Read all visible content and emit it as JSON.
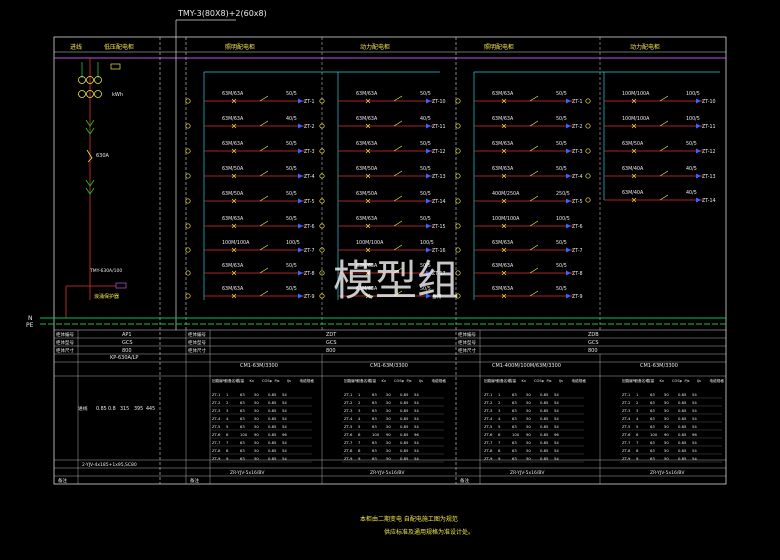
{
  "drawing": {
    "busbar_label": "TMY-3(80X8)+2(60x8)",
    "line_n": "N",
    "line_pe": "PE",
    "watermark": "模型组",
    "note_line1": "本柜由二期变电 自配电施工图为规范",
    "note_line2": "供应标准及通用规格为准设计处。"
  },
  "panels": [
    {
      "id": "incoming",
      "headers": [
        "进线",
        "低压配电柜"
      ],
      "breaker_note": "630A",
      "meter_label": "kWh",
      "ct_label": "TMY-630A/100",
      "spd_label": "浪涌保护器"
    },
    {
      "id": "p2",
      "headers": [
        "照明配电柜",
        "动力配电柜"
      ],
      "circuits": [
        {
          "rating": "63M/63A",
          "fuse": "50/5",
          "code": "ZT-1",
          "code2": "ZT-10"
        },
        {
          "rating": "63M/63A",
          "fuse": "40/5",
          "code": "ZT-2",
          "code2": "ZT-11"
        },
        {
          "rating": "63M/63A",
          "fuse": "50/5",
          "code": "ZT-3",
          "code2": "ZT-12"
        },
        {
          "rating": "63M/50A",
          "fuse": "50/5",
          "code": "ZT-4",
          "code2": "ZT-13"
        },
        {
          "rating": "63M/50A",
          "fuse": "50/5",
          "code": "ZT-5",
          "code2": "ZT-14"
        },
        {
          "rating": "63M/63A",
          "fuse": "50/5",
          "code": "ZT-6",
          "code2": "ZT-15"
        },
        {
          "rating": "100M/100A",
          "fuse": "100/5",
          "code": "ZT-7",
          "code2": "ZT-16"
        },
        {
          "rating": "63M/63A",
          "fuse": "50/5",
          "code": "ZT-8",
          "code2": "ZT-17"
        },
        {
          "rating": "63M/63A",
          "fuse": "50/5",
          "code": "ZT-9",
          "code2": "备用"
        }
      ]
    },
    {
      "id": "p3",
      "headers": [
        "照明配电柜",
        "动力配电柜"
      ],
      "circuits": [
        {
          "rating": "63M/63A",
          "fuse": "50/5",
          "code": "ZT-1",
          "code2": "ZT-10"
        },
        {
          "rating": "63M/63A",
          "fuse": "50/5",
          "code": "ZT-2",
          "code2": "ZT-11"
        },
        {
          "rating": "63M/63A",
          "fuse": "50/5",
          "code": "ZT-3",
          "code2": "ZT-12"
        },
        {
          "rating": "63M/63A",
          "fuse": "50/5",
          "code": "ZT-4",
          "code2": "ZT-13"
        },
        {
          "rating": "400M/250A",
          "fuse": "250/5",
          "code": "ZT-5",
          "code2": "ZT-14"
        },
        {
          "rating": "100M/100A",
          "fuse": "100/5",
          "code": "ZT-6"
        },
        {
          "rating": "63M/63A",
          "fuse": "50/5",
          "code": "ZT-7"
        },
        {
          "rating": "63M/63A",
          "fuse": "50/5",
          "code": "ZT-8"
        },
        {
          "rating": "63M/63A",
          "fuse": "50/5",
          "code": "ZT-9"
        }
      ],
      "right_circuits": [
        {
          "rating": "100M/100A",
          "fuse": "100/5",
          "code": "ZT-10"
        },
        {
          "rating": "100M/100A",
          "fuse": "100/5",
          "code": "ZT-11"
        },
        {
          "rating": "63M/50A",
          "fuse": "50/5",
          "code": "ZT-12"
        },
        {
          "rating": "63M/40A",
          "fuse": "40/5",
          "code": "ZT-13"
        },
        {
          "rating": "63M/40A",
          "fuse": "40/5",
          "code": "ZT-14"
        }
      ]
    }
  ],
  "table": {
    "row_labels": [
      "柜体编号",
      "柜体型号",
      "柜体尺寸"
    ],
    "cabinet_ids": [
      "AP1",
      "ZDT",
      "ZDB"
    ],
    "cabinet_types": [
      "GCS",
      "GCS",
      "GCS"
    ],
    "cabinet_sizes": [
      "800",
      "800",
      "800"
    ],
    "breaker_models": [
      "KP-630A/LP",
      "CM1-63M/3300",
      "CM1-63M/3300",
      "CM1-400M/100M/63M/3300",
      "CM1-63M/3300"
    ],
    "col_headers": [
      "回路编号",
      "设备名称",
      "容量",
      "Kx",
      "COSφ",
      "Pjs",
      "Ijs",
      "电缆规格"
    ],
    "incoming_values": [
      "进线",
      "0.85",
      "0.8",
      "315",
      "395",
      "445"
    ],
    "footer_cables": [
      "2-YJV-4x185+1x95,SC80",
      "ZR-YJV-5x16/BV",
      "ZR-YJV-5x16/BV",
      "ZR-YJV-5x16/BV",
      "ZR-YJV-5x16/BV"
    ],
    "footer_note": "备注",
    "rows": [
      [
        "ZT-1",
        "1",
        "63",
        "50",
        "0.85",
        "54"
      ],
      [
        "ZT-2",
        "2",
        "63",
        "50",
        "0.85",
        "54"
      ],
      [
        "ZT-3",
        "3",
        "63",
        "50",
        "0.85",
        "54"
      ],
      [
        "ZT-4",
        "4",
        "63",
        "50",
        "0.85",
        "54"
      ],
      [
        "ZT-5",
        "5",
        "63",
        "50",
        "0.85",
        "54"
      ],
      [
        "ZT-6",
        "6",
        "100",
        "90",
        "0.85",
        "96"
      ],
      [
        "ZT-7",
        "7",
        "63",
        "50",
        "0.85",
        "54"
      ],
      [
        "ZT-8",
        "8",
        "63",
        "50",
        "0.85",
        "54"
      ],
      [
        "ZT-9",
        "9",
        "63",
        "50",
        "0.85",
        "54"
      ]
    ]
  },
  "colors": {
    "bg": "#000000",
    "frame": "#e6e6e6",
    "busbar": "#c050e0",
    "n_line": "#00c060",
    "green": "#24c030",
    "red": "#e03030",
    "yellow": "#f2e64a",
    "orange": "#f0b040",
    "cyan": "#20d0e0",
    "blue": "#4060ff"
  }
}
